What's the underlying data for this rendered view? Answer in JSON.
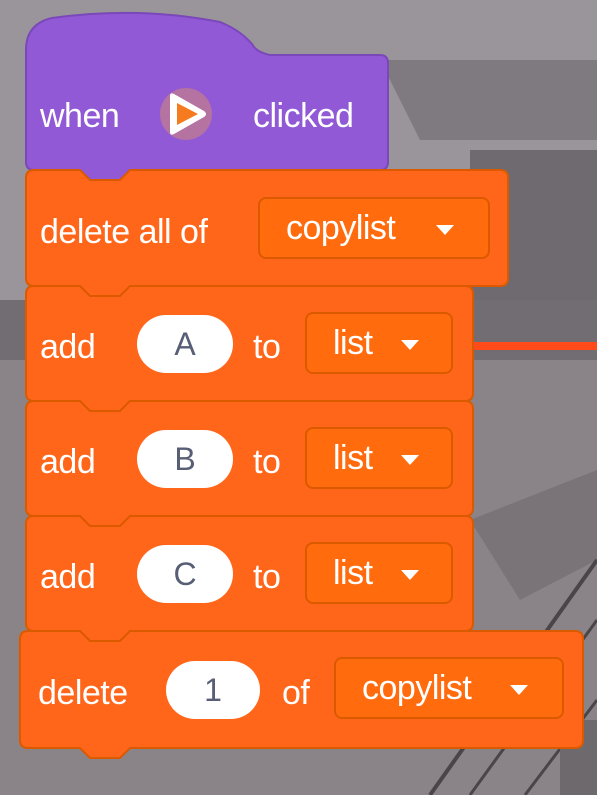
{
  "script": {
    "hat": {
      "when_label": "when",
      "flag_icon": "green-flag-icon",
      "clicked_label": "clicked"
    },
    "delete_all": {
      "label": "delete all of",
      "list_name": "copylist"
    },
    "add_blocks": [
      {
        "label": "add",
        "value": "A",
        "to_label": "to",
        "list_name": "list"
      },
      {
        "label": "add",
        "value": "B",
        "to_label": "to",
        "list_name": "list"
      },
      {
        "label": "add",
        "value": "C",
        "to_label": "to",
        "list_name": "list"
      }
    ],
    "delete_item": {
      "label": "delete",
      "index": "1",
      "of_label": "of",
      "list_name": "copylist"
    }
  },
  "colors": {
    "events_block": "#9159d6",
    "list_block": "#ff661a",
    "list_block_border": "#db5a00",
    "input_text": "#575e75"
  }
}
